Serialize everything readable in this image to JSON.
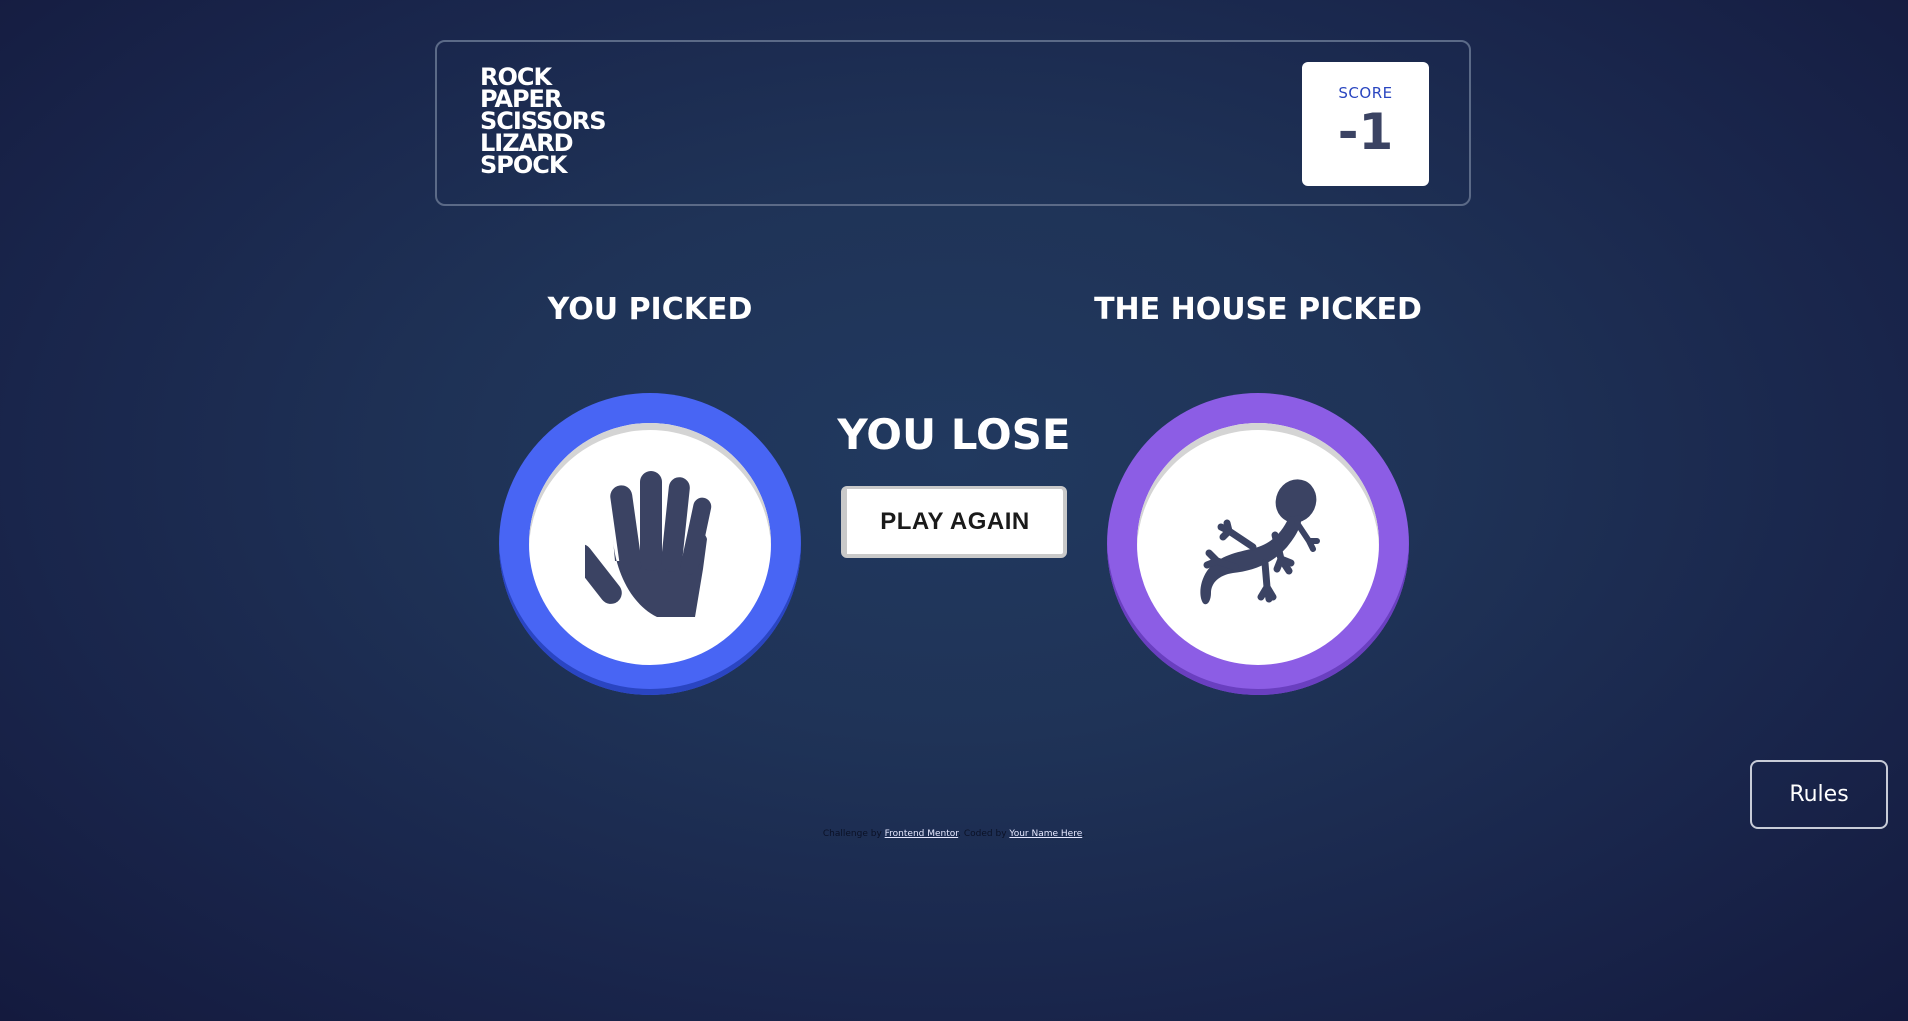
{
  "header": {
    "title_lines": [
      "ROCK",
      "PAPER",
      "SCISSORS",
      "LIZARD",
      "SPOCK"
    ],
    "score_label": "SCORE",
    "score_value": "-1"
  },
  "game": {
    "player_heading": "YOU PICKED",
    "house_heading": "THE HOUSE PICKED",
    "player_pick": {
      "icon": "paper-hand-icon",
      "ring_color": "#4865f4"
    },
    "house_pick": {
      "icon": "lizard-icon",
      "ring_color": "#8c5de5"
    },
    "result_text": "YOU LOSE",
    "play_again_label": "PLAY AGAIN"
  },
  "rules_button_label": "Rules",
  "footer": {
    "challenge_prefix": "Challenge by",
    "challenge_link": "Frontend Mentor",
    "coded_prefix": ". Coded by",
    "coded_link": "Your Name Here",
    "suffix": "."
  },
  "colors": {
    "icon": "#3b4363",
    "score_label": "#2a46c0"
  }
}
